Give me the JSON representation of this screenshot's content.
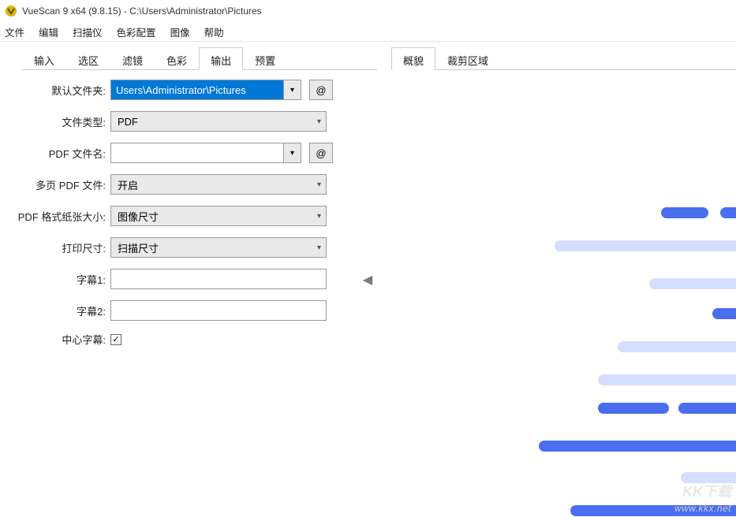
{
  "title": "VueScan 9 x64 (9.8.15)  -  C:\\Users\\Administrator\\Pictures",
  "menu": [
    "文件",
    "编辑",
    "扫描仪",
    "色彩配置",
    "图像",
    "帮助"
  ],
  "left_tabs": [
    "输入",
    "选区",
    "滤镜",
    "色彩",
    "输出",
    "预置"
  ],
  "left_active_tab": 4,
  "right_tabs": [
    "概貌",
    "裁剪区域"
  ],
  "right_active_tab": 0,
  "form": {
    "default_folder_label": "默认文件夹:",
    "default_folder_value": "Users\\Administrator\\Pictures",
    "file_type_label": "文件类型:",
    "file_type_value": "PDF",
    "pdf_filename_label": "PDF 文件名:",
    "pdf_filename_value": "",
    "multipage_label": "多页 PDF 文件:",
    "multipage_value": "开启",
    "pdf_papersize_label": "PDF 格式纸张大小:",
    "pdf_papersize_value": "图像尺寸",
    "print_size_label": "打印尺寸:",
    "print_size_value": "扫描尺寸",
    "subtitle1_label": "字幕1:",
    "subtitle1_value": "",
    "subtitle2_label": "字幕2:",
    "subtitle2_value": "",
    "center_subtitle_label": "中心字幕:",
    "center_subtitle_checked": true,
    "at_button": "@"
  },
  "watermark": "www.kkx.net",
  "watermark_logo": "KK下载"
}
